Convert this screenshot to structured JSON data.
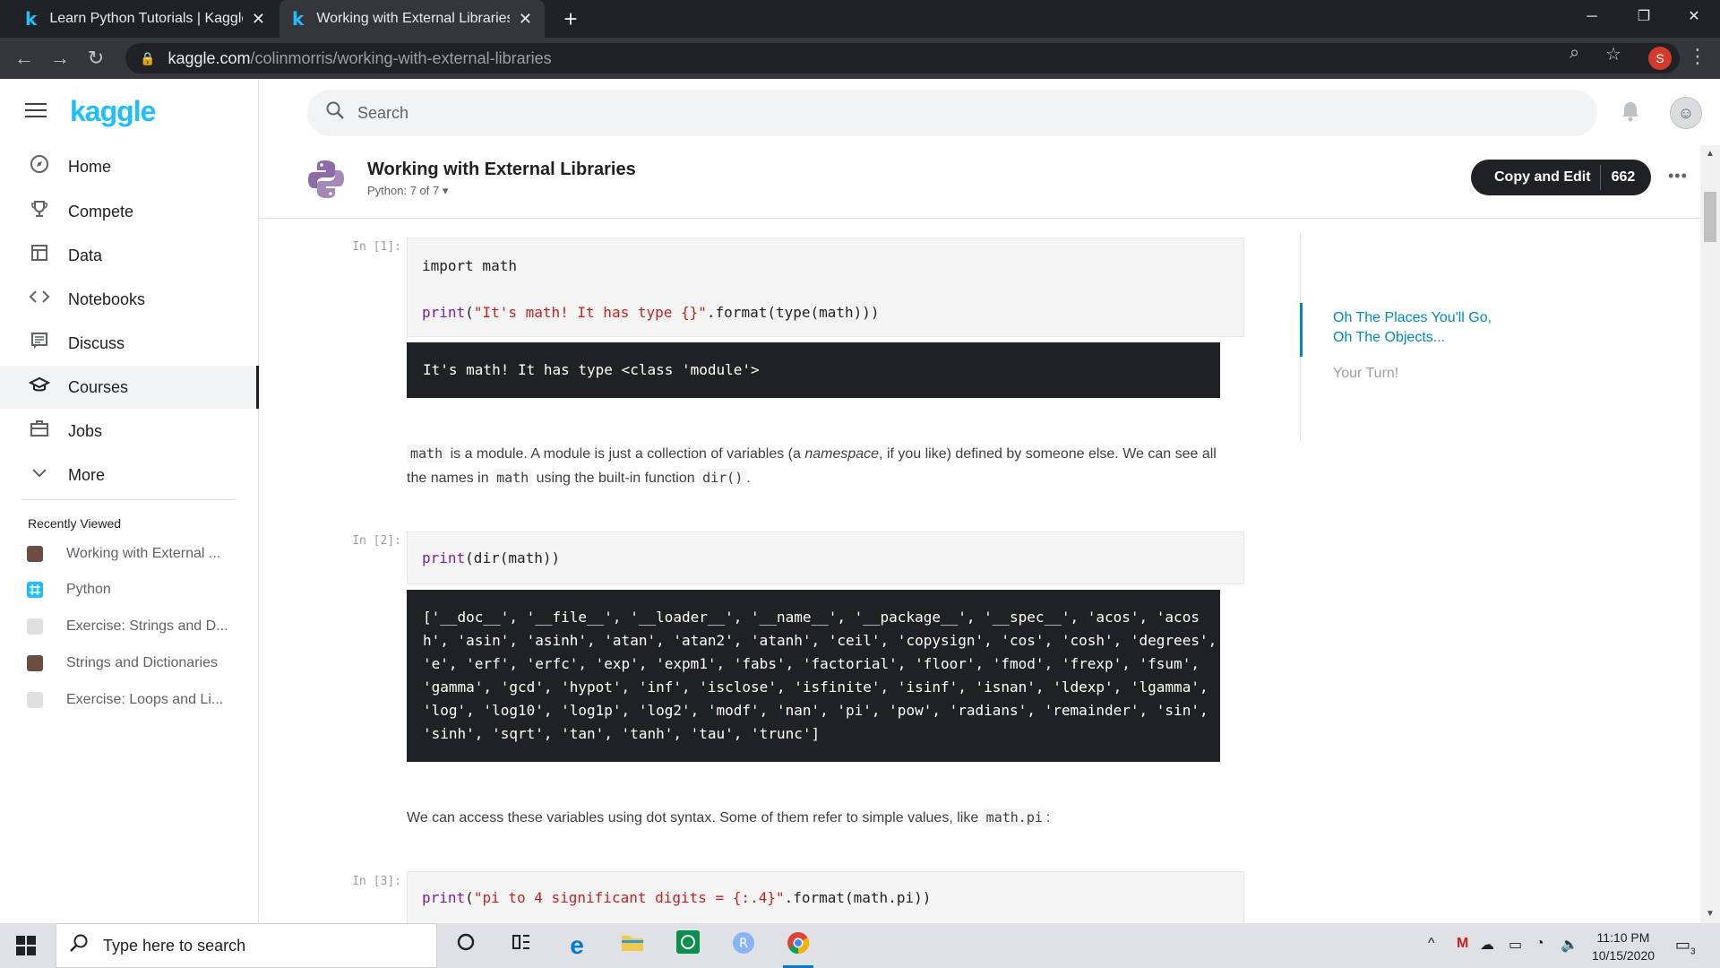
{
  "browser": {
    "tabs": [
      {
        "title": "Learn Python Tutorials | Kaggle",
        "active": false
      },
      {
        "title": "Working with External Libraries | K",
        "active": true
      }
    ],
    "url_host": "kaggle.com",
    "url_path": "/colinmorris/working-with-external-libraries",
    "profile_initial": "S"
  },
  "sidebar": {
    "logo": "kaggle",
    "nav": [
      {
        "label": "Home",
        "icon": "compass-icon",
        "glyph": "⊘"
      },
      {
        "label": "Compete",
        "icon": "trophy-icon",
        "glyph": "🏆"
      },
      {
        "label": "Data",
        "icon": "table-icon",
        "glyph": "▦"
      },
      {
        "label": "Notebooks",
        "icon": "code-icon",
        "glyph": "<>"
      },
      {
        "label": "Discuss",
        "icon": "comment-icon",
        "glyph": "▤"
      },
      {
        "label": "Courses",
        "icon": "graduation-cap-icon",
        "glyph": "🎓"
      },
      {
        "label": "Jobs",
        "icon": "briefcase-icon",
        "glyph": "💼"
      },
      {
        "label": "More",
        "icon": "chevron-down-icon",
        "glyph": "⌄"
      }
    ],
    "active_nav": "Courses",
    "recent_title": "Recently Viewed",
    "recent": [
      {
        "label": "Working with External ...",
        "thumb": "avatar"
      },
      {
        "label": "Python",
        "thumb": "course"
      },
      {
        "label": "Exercise: Strings and D...",
        "thumb": "avatar-light"
      },
      {
        "label": "Strings and Dictionaries",
        "thumb": "avatar"
      },
      {
        "label": "Exercise: Loops and Li...",
        "thumb": "avatar-light"
      }
    ]
  },
  "header": {
    "search_placeholder": "Search"
  },
  "notebook": {
    "title": "Working with External Libraries",
    "subtitle": "Python: 7 of 7",
    "copy_edit_label": "Copy and Edit",
    "copy_edit_count": "662",
    "cells": {
      "in1_prompt": "In [1]:",
      "in1_line1": "import math",
      "in1_line2_fn": "print",
      "in1_line2_str": "\"It's math! It has type {}\"",
      "in1_line2_rest": ".format(type(math)))",
      "out1": "It's math! It has type <class 'module'>",
      "md1_code1": "math",
      "md1_text1": " is a module. A module is just a collection of variables (a ",
      "md1_em": "namespace",
      "md1_text2": ", if you like) defined by someone else. We can see all the names in ",
      "md1_code2": "math",
      "md1_text3": " using the built-in function ",
      "md1_code3": "dir()",
      "md1_text4": ".",
      "in2_prompt": "In [2]:",
      "in2_fn": "print",
      "in2_rest": "(dir(math))",
      "out2": [
        "['__doc__', '__file__', '__loader__', '__name__', '__package__', '__spec__', 'acos', 'acos",
        "h', 'asin', 'asinh', 'atan', 'atan2', 'atanh', 'ceil', 'copysign', 'cos', 'cosh', 'degrees',",
        "'e', 'erf', 'erfc', 'exp', 'expm1', 'fabs', 'factorial', 'floor', 'fmod', 'frexp', 'fsum',",
        "'gamma', 'gcd', 'hypot', 'inf', 'isclose', 'isfinite', 'isinf', 'isnan', 'ldexp', 'lgamma',",
        "'log', 'log10', 'log1p', 'log2', 'modf', 'nan', 'pi', 'pow', 'radians', 'remainder', 'sin',",
        "'sinh', 'sqrt', 'tan', 'tanh', 'tau', 'trunc']"
      ],
      "md2_text": "We can access these variables using dot syntax. Some of them refer to simple values, like ",
      "md2_code": "math.pi",
      "md2_end": ":",
      "in3_prompt": "In [3]:",
      "in3_fn": "print",
      "in3_str": "\"pi to 4 significant digits = {:.4}\"",
      "in3_rest": ".format(math.pi))"
    }
  },
  "toc": {
    "items": [
      {
        "label": "Oh The Places You'll Go, Oh The Objects...",
        "active": true
      },
      {
        "label": "Your Turn!",
        "active": false
      }
    ]
  },
  "taskbar": {
    "search_placeholder": "Type here to search",
    "time": "11:10 PM",
    "date": "10/15/2020",
    "notification_count": "3"
  },
  "colors": {
    "kaggle_blue": "#20beff",
    "toc_active": "#008abc",
    "dark": "#202124"
  }
}
